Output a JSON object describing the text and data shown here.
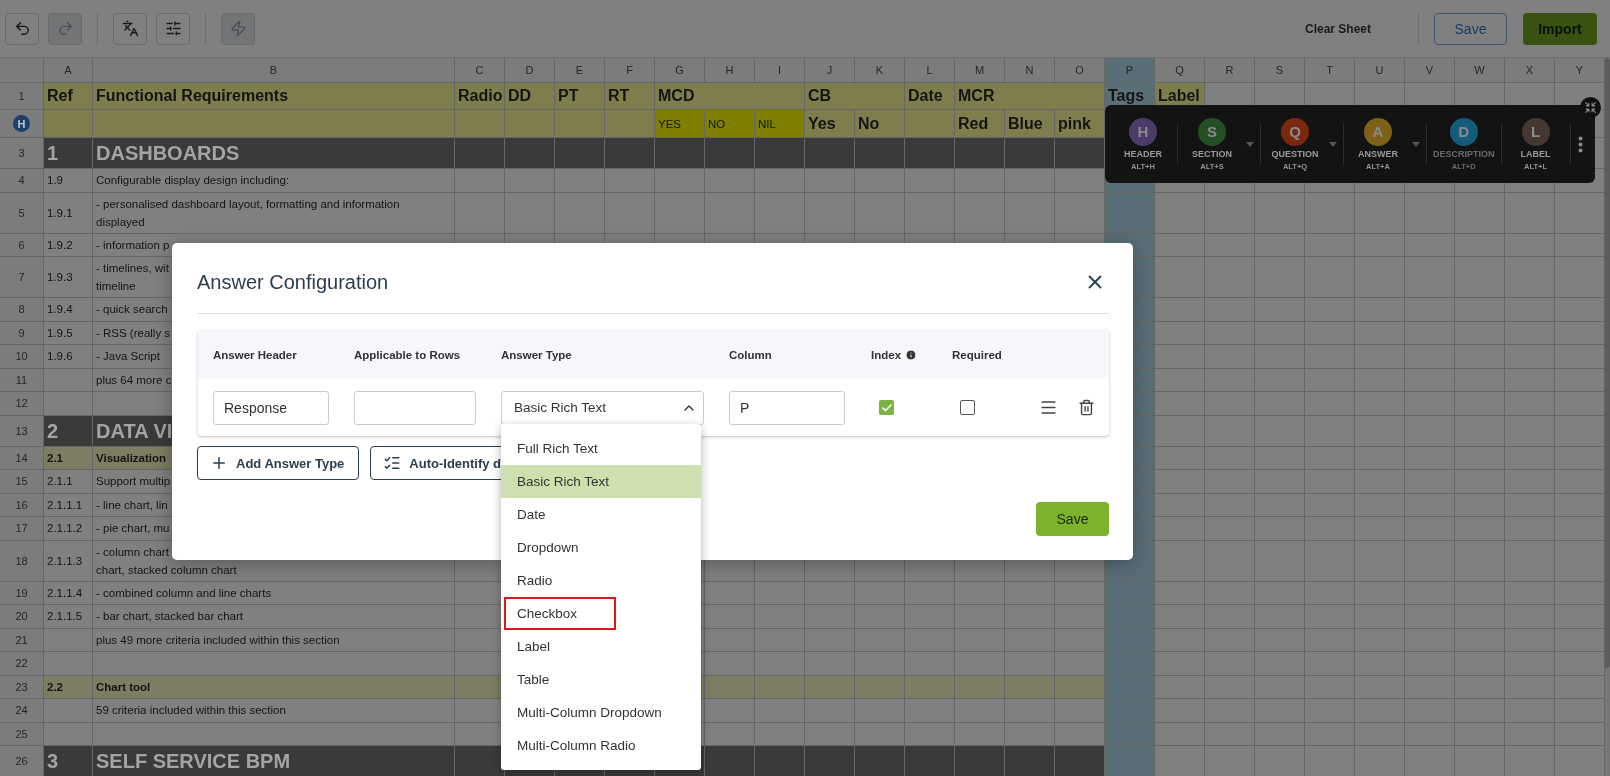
{
  "toolbar": {
    "groups": [
      [
        {
          "kind": "undo",
          "disabled": false
        },
        {
          "kind": "redo",
          "disabled": true
        }
      ],
      [
        {
          "kind": "translate",
          "disabled": false
        },
        {
          "kind": "sliders",
          "disabled": false
        }
      ],
      [
        {
          "kind": "flash",
          "disabled": true
        }
      ]
    ],
    "actions": [
      {
        "kind": "link",
        "label": "Clear Sheet"
      },
      {
        "kind": "outline",
        "label": "Save"
      },
      {
        "kind": "primary",
        "label": "Import"
      }
    ]
  },
  "sheet": {
    "columns": [
      {
        "label": "A",
        "selected": false
      },
      {
        "label": "B",
        "selected": false
      },
      {
        "label": "C",
        "selected": false
      },
      {
        "label": "D",
        "selected": false
      },
      {
        "label": "E",
        "selected": false
      },
      {
        "label": "F",
        "selected": false
      },
      {
        "label": "G",
        "selected": false
      },
      {
        "label": "H",
        "selected": false
      },
      {
        "label": "I",
        "selected": false
      },
      {
        "label": "J",
        "selected": false
      },
      {
        "label": "K",
        "selected": false
      },
      {
        "label": "L",
        "selected": false
      },
      {
        "label": "M",
        "selected": false
      },
      {
        "label": "N",
        "selected": false
      },
      {
        "label": "O",
        "selected": false
      },
      {
        "label": "P",
        "selected": true
      },
      {
        "label": "Q",
        "selected": false
      },
      {
        "label": "R",
        "selected": false
      },
      {
        "label": "S",
        "selected": false
      },
      {
        "label": "T",
        "selected": false
      },
      {
        "label": "U",
        "selected": false
      },
      {
        "label": "V",
        "selected": false
      },
      {
        "label": "W",
        "selected": false
      },
      {
        "label": "X",
        "selected": false
      },
      {
        "label": "Y",
        "selected": false
      }
    ],
    "header": {
      "number": "1",
      "sub_number": "H",
      "cells": [
        {
          "text": "Ref"
        },
        {
          "text": "Functional Requirements"
        },
        {
          "text": "Radio"
        },
        {
          "text": "DD"
        },
        {
          "text": "PT"
        },
        {
          "text": "RT"
        },
        {
          "text": "MCD",
          "options": [
            {
              "text": "YES",
              "highlight": true
            },
            {
              "text": "NO",
              "highlight": true
            },
            {
              "text": "NIL",
              "highlight": true
            }
          ]
        },
        {
          "text": "CB",
          "options": [
            {
              "text": "Yes",
              "highlight": false
            },
            {
              "text": "No",
              "highlight": false
            }
          ]
        },
        {
          "text": "Date"
        },
        {
          "text": "MCR",
          "options": [
            {
              "text": "Red",
              "highlight": false
            },
            {
              "text": "Blue",
              "highlight": false
            },
            {
              "text": "pink",
              "highlight": false
            }
          ]
        },
        {
          "text": "Tags"
        },
        {
          "text": "Label"
        }
      ]
    },
    "rows": [
      {
        "number": "3",
        "kind": "section",
        "ref": "1",
        "text": "DASHBOARDS"
      },
      {
        "number": "4",
        "kind": "item",
        "ref": "1.9",
        "text": "Configurable display design including:"
      },
      {
        "number": "5",
        "kind": "item",
        "ref": "1.9.1",
        "text": "- personalised dashboard layout, formatting and information\ndisplayed"
      },
      {
        "number": "6",
        "kind": "item",
        "ref": "1.9.2",
        "text": "- information p"
      },
      {
        "number": "7",
        "kind": "item",
        "ref": "1.9.3",
        "text": "- timelines, wit\ntimeline"
      },
      {
        "number": "8",
        "kind": "item",
        "ref": "1.9.4",
        "text": "- quick search"
      },
      {
        "number": "9",
        "kind": "item",
        "ref": "1.9.5",
        "text": "- RSS (really s"
      },
      {
        "number": "10",
        "kind": "item",
        "ref": "1.9.6",
        "text": "- Java Script"
      },
      {
        "number": "11",
        "kind": "item",
        "text": "plus 64 more c"
      },
      {
        "number": "12",
        "kind": "blank"
      },
      {
        "number": "13",
        "kind": "section",
        "ref": "2",
        "text": "DATA VI"
      },
      {
        "number": "14",
        "kind": "subsection",
        "ref": "2.1",
        "text": "Visualization"
      },
      {
        "number": "15",
        "kind": "item",
        "ref": "2.1.1",
        "text": "Support multip"
      },
      {
        "number": "16",
        "kind": "item",
        "ref": "2.1.1.1",
        "text": "- line chart, lin"
      },
      {
        "number": "17",
        "kind": "item",
        "ref": "2.1.1.2",
        "text": "- pie chart, mu"
      },
      {
        "number": "18",
        "kind": "item",
        "ref": "2.1.1.3",
        "text": "- column chart\nchart, stacked column chart"
      },
      {
        "number": "19",
        "kind": "item",
        "ref": "2.1.1.4",
        "text": "- combined column and line charts"
      },
      {
        "number": "20",
        "kind": "item",
        "ref": "2.1.1.5",
        "text": "- bar chart, stacked bar chart"
      },
      {
        "number": "21",
        "kind": "item",
        "text": "plus 49 more criteria included within this section"
      },
      {
        "number": "22",
        "kind": "blank"
      },
      {
        "number": "23",
        "kind": "subsection",
        "ref": "2.2",
        "text": "Chart tool"
      },
      {
        "number": "24",
        "kind": "item",
        "text": "59 criteria included within this section"
      },
      {
        "number": "25",
        "kind": "blank"
      },
      {
        "number": "26",
        "kind": "section",
        "ref": "3",
        "text": "SELF SERVICE BPM"
      }
    ]
  },
  "tools": {
    "items": [
      {
        "letter": "H",
        "label": "HEADER",
        "shortcut": "ALT+H",
        "color": "#4b3b67",
        "has_menu": false,
        "disabled": false
      },
      {
        "letter": "S",
        "label": "SECTION",
        "shortcut": "ALT+S",
        "color": "#225024",
        "has_menu": true,
        "disabled": false
      },
      {
        "letter": "Q",
        "label": "QUESTION",
        "shortcut": "ALT+Q",
        "color": "#7a290f",
        "has_menu": true,
        "disabled": false
      },
      {
        "letter": "A",
        "label": "ANSWER",
        "shortcut": "ALT+A",
        "color": "#7e6017",
        "has_menu": true,
        "disabled": false
      },
      {
        "letter": "D",
        "label": "DESCRIPTION",
        "shortcut": "ALT+D",
        "color": "#155b7b",
        "has_menu": false,
        "disabled": true
      },
      {
        "letter": "L",
        "label": "LABEL",
        "shortcut": "ALT+L",
        "color": "#473732",
        "has_menu": false,
        "disabled": false
      }
    ]
  },
  "dialog": {
    "title": "Answer Configuration",
    "columns": [
      {
        "label": "Answer Header",
        "info": false
      },
      {
        "label": "Applicable to Rows",
        "info": false
      },
      {
        "label": "Answer Type",
        "info": false
      },
      {
        "label": "Column",
        "info": false
      },
      {
        "label": "Index",
        "info": true
      },
      {
        "label": "Required",
        "info": false
      }
    ],
    "answers": [
      {
        "header": "Response",
        "type": "Basic Rich Text",
        "expanded": true,
        "column": "P",
        "index": true,
        "required": false
      }
    ],
    "buttons": [
      {
        "kind": "add",
        "label": "Add Answer Type"
      },
      {
        "kind": "auto",
        "label": "Auto-Identify d"
      }
    ],
    "save": "Save"
  },
  "dropdown": {
    "options": [
      {
        "label": "Full Rich Text",
        "selected": false,
        "outlined": false
      },
      {
        "label": "Basic Rich Text",
        "selected": true,
        "outlined": false
      },
      {
        "label": "Date",
        "selected": false,
        "outlined": false
      },
      {
        "label": "Dropdown",
        "selected": false,
        "outlined": false
      },
      {
        "label": "Radio",
        "selected": false,
        "outlined": false
      },
      {
        "label": "Checkbox",
        "selected": false,
        "outlined": true
      },
      {
        "label": "Label",
        "selected": false,
        "outlined": false
      },
      {
        "label": "Table",
        "selected": false,
        "outlined": false
      },
      {
        "label": "Multi-Column Dropdown",
        "selected": false,
        "outlined": false
      },
      {
        "label": "Multi-Column Radio",
        "selected": false,
        "outlined": false
      }
    ]
  }
}
